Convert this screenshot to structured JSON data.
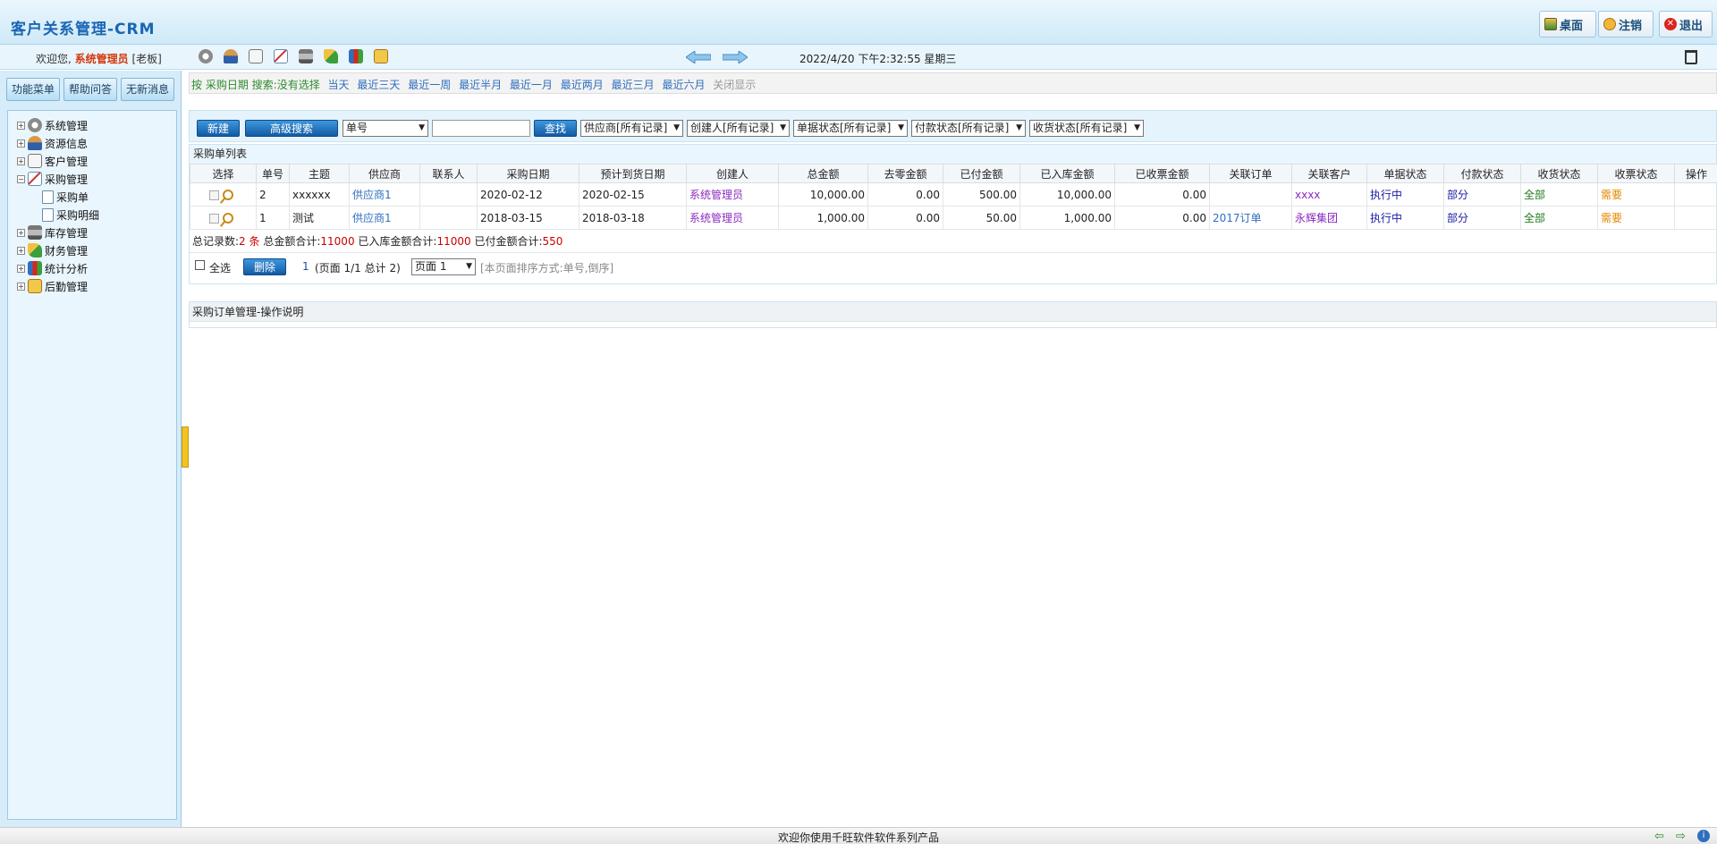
{
  "header": {
    "title": "客户关系管理-CRM",
    "buttons": {
      "desktop": "桌面",
      "logout": "注销",
      "exit": "退出"
    }
  },
  "subbar": {
    "welcome_prefix": "欢迎您,",
    "username": "系统管理员",
    "role": "[老板]",
    "datetime": "2022/4/20 下午2:32:55 星期三"
  },
  "left": {
    "tabs": {
      "menu": "功能菜单",
      "help": "帮助问答",
      "messages": "无新消息"
    },
    "tree": {
      "system": "系统管理",
      "resources": "资源信息",
      "customers": "客户管理",
      "purchase": "采购管理",
      "purchase_order": "采购单",
      "purchase_detail": "采购明细",
      "inventory": "库存管理",
      "finance": "财务管理",
      "stats": "统计分析",
      "logistics": "后勤管理"
    }
  },
  "filter": {
    "by_label": "按 采购日期",
    "search_label": "搜索:没有选择",
    "links": [
      "当天",
      "最近三天",
      "最近一周",
      "最近半月",
      "最近一月",
      "最近两月",
      "最近三月",
      "最近六月"
    ],
    "close": "关闭显示"
  },
  "toolbar": {
    "new": "新建",
    "advanced": "高级搜索",
    "field_select": "单号",
    "find": "查找",
    "supplier": "供应商[所有记录]",
    "creator": "创建人[所有记录]",
    "doc_status": "单据状态[所有记录]",
    "pay_status": "付款状态[所有记录]",
    "recv_status": "收货状态[所有记录]"
  },
  "list": {
    "title": "采购单列表",
    "columns": [
      "选择",
      "单号",
      "主题",
      "供应商",
      "联系人",
      "采购日期",
      "预计到货日期",
      "创建人",
      "总金额",
      "去零金额",
      "已付金额",
      "已入库金额",
      "已收票金额",
      "关联订单",
      "关联客户",
      "单据状态",
      "付款状态",
      "收货状态",
      "收票状态",
      "操作"
    ],
    "rows": [
      {
        "no": "2",
        "subject": "xxxxxx",
        "supplier": "供应商1",
        "contact": "",
        "date": "2020-02-12",
        "eta": "2020-02-15",
        "creator": "系统管理员",
        "total": "10,000.00",
        "rounding": "0.00",
        "paid": "500.00",
        "stocked": "10,000.00",
        "invoiced": "0.00",
        "order": "",
        "customer": "xxxx",
        "doc_status": "执行中",
        "pay_status": "部分",
        "recv_status": "全部",
        "inv_status": "需要",
        "op": ""
      },
      {
        "no": "1",
        "subject": "测试",
        "supplier": "供应商1",
        "contact": "",
        "date": "2018-03-15",
        "eta": "2018-03-18",
        "creator": "系统管理员",
        "total": "1,000.00",
        "rounding": "0.00",
        "paid": "50.00",
        "stocked": "1,000.00",
        "invoiced": "0.00",
        "order": "2017订单",
        "customer": "永辉集团",
        "doc_status": "执行中",
        "pay_status": "部分",
        "recv_status": "全部",
        "inv_status": "需要",
        "op": ""
      }
    ],
    "summary": {
      "count_label": "总记录数:",
      "count": "2",
      "count_unit": "条",
      "total_label": "总金额合计:",
      "total": "11000",
      "stocked_label": "已入库金额合计:",
      "stocked": "11000",
      "paid_label": "已付金额合计:",
      "paid": "550"
    },
    "pager": {
      "select_all": "全选",
      "delete": "删除",
      "page_current": "1",
      "page_info": "(页面 1/1  总计 2)",
      "page_select": "页面 1",
      "sort_info": "[本页面排序方式:单号,倒序]"
    }
  },
  "help": {
    "title": "采购订单管理-操作说明"
  },
  "footer": {
    "text": "欢迎你使用千旺软件软件系列产品"
  },
  "colors": {
    "accent": "#1a66b3",
    "button_blue": "#1a6dbf",
    "panel": "#d7ecf9"
  }
}
